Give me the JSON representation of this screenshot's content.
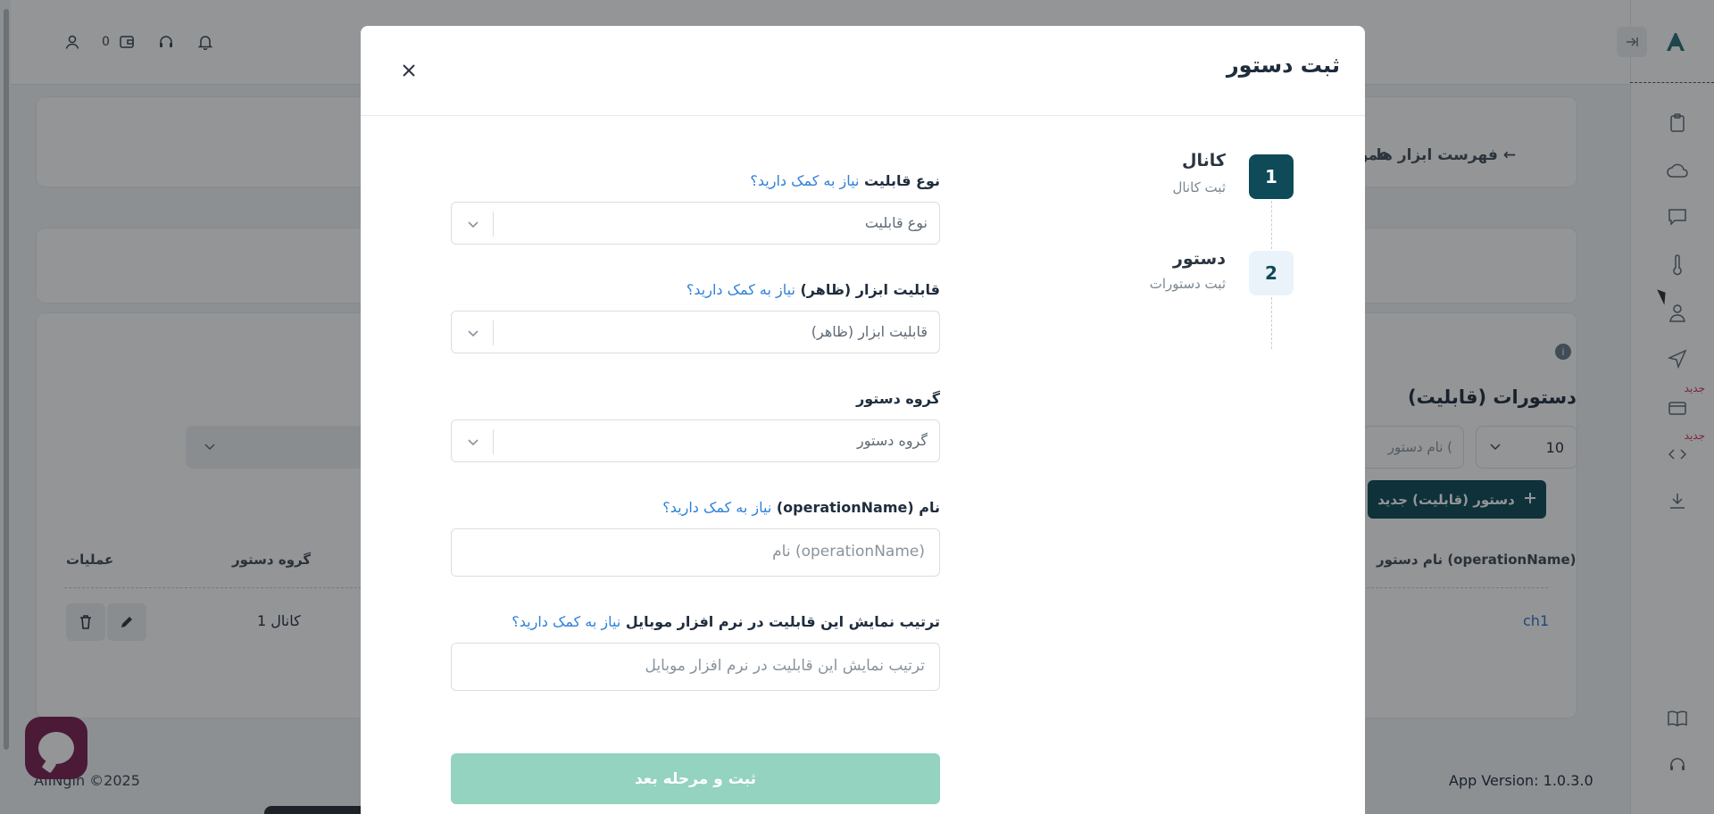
{
  "topbar": {
    "wallet_count": "0"
  },
  "breadcrumb": {
    "back_label": "← فهرست ابزار ها",
    "partial": "عمو"
  },
  "section": {
    "title": "دستورات (قابلیت)",
    "info": "i"
  },
  "toolbar": {
    "page_size": "10",
    "name_search_placeholder": "نام دستور (",
    "new_button": "دستور (قابلیت) جدید"
  },
  "rail": {
    "new_badge": "جدید"
  },
  "table": {
    "headers": {
      "name": "نام دستور (operationName)",
      "group": "گروه دستور",
      "actions": "عملیات"
    },
    "row": {
      "name": "ch1",
      "group": "کانال 1"
    }
  },
  "footer": {
    "copyright": "AIINgin ©2025",
    "version": "App Version: 1.0.3.0"
  },
  "modal": {
    "title": "ثبت دستور",
    "steps": [
      {
        "number": "1",
        "title": "کانال",
        "subtitle": "ثبت کانال"
      },
      {
        "number": "2",
        "title": "دستور",
        "subtitle": "ثبت دستورات"
      }
    ],
    "help_text": "نیاز به کمک دارید؟",
    "fields": {
      "capability_type": {
        "label": "نوع قابلیت",
        "placeholder": "نوع قابلیت"
      },
      "tool_capability": {
        "label": "قابلیت ابزار (ظاهر)",
        "placeholder": "قابلیت ابزار (ظاهر)"
      },
      "command_group": {
        "label": "گروه دستور",
        "placeholder": "گروه دستور"
      },
      "operation_name": {
        "label": "نام (operationName)",
        "placeholder": "نام (operationName)"
      },
      "display_order": {
        "label": "ترتیب نمایش این قابلیت در نرم افزار موبایل",
        "placeholder": "ترتیب نمایش این قابلیت در نرم افزار موبایل"
      }
    },
    "submit": "ثبت و مرحله بعد"
  },
  "colors": {
    "primary": "#0e4a57",
    "submit_disabled": "#93d3bf",
    "help_link": "#2f80d8"
  }
}
